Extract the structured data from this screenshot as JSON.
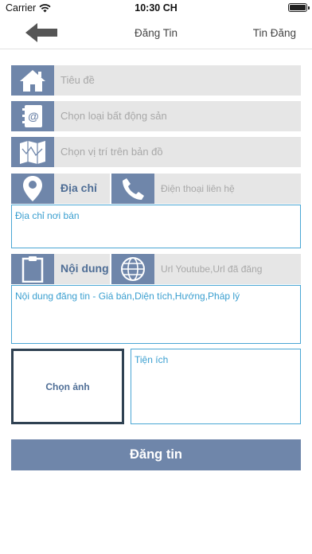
{
  "status_bar": {
    "carrier": "Carrier",
    "time": "10:30 CH"
  },
  "nav": {
    "title": "Đăng Tin",
    "action": "Tin Đăng"
  },
  "form": {
    "title_placeholder": "Tiêu đề",
    "property_type_placeholder": "Chọn loại bất động sản",
    "map_placeholder": "Chọn vị trí trên bản đồ",
    "address_label": "Địa chỉ",
    "phone_placeholder": "Điện thoại liên hệ",
    "address_textarea_placeholder": "Địa chỉ nơi bán",
    "content_label": "Nội dung",
    "youtube_placeholder": "Url Youtube,Url đã đăng",
    "content_textarea_placeholder": "Nội dung đăng tin - Giá bán,Diện tích,Hướng,Pháp lý",
    "choose_photo": "Chọn ảnh",
    "amenities_placeholder": "Tiện ích",
    "submit": "Đăng tin"
  },
  "colors": {
    "accent": "#6f86aa",
    "field_bg": "#e6e6e6",
    "border_blue": "#4aa6d4",
    "label_text": "#4f6e96"
  }
}
